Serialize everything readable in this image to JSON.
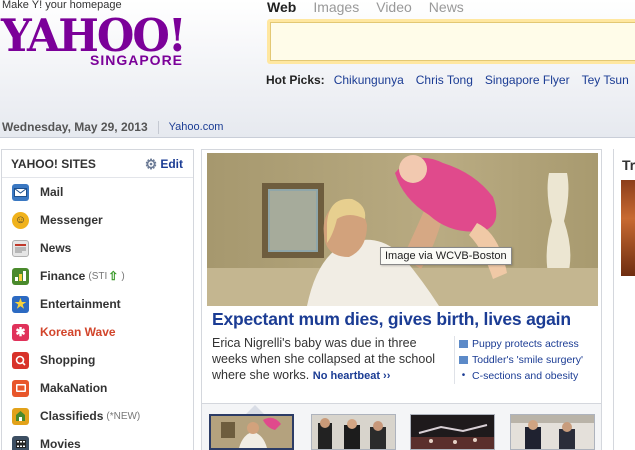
{
  "header": {
    "make_homepage": "Make Y! your homepage",
    "logo_word": "YAHOO!",
    "logo_region": "SINGAPORE",
    "search_tabs": [
      "Web",
      "Images",
      "Video",
      "News"
    ],
    "search_placeholder": "",
    "hot_picks_label": "Hot Picks:",
    "hot_picks": [
      "Chikungunya",
      "Chris Tong",
      "Singapore Flyer",
      "Tey Tsun"
    ],
    "date": "Wednesday, May 29, 2013",
    "site_link": "Yahoo.com"
  },
  "sidebar": {
    "title": "YAHOO! SITES",
    "edit_label": "Edit",
    "items": [
      {
        "label": "Mail",
        "suffix": "",
        "icon": "mail-icon",
        "color": "#3a78c2"
      },
      {
        "label": "Messenger",
        "suffix": "",
        "icon": "messenger-icon",
        "color": "#f0b21c"
      },
      {
        "label": "News",
        "suffix": "",
        "icon": "news-icon",
        "color": "#d9d9d9"
      },
      {
        "label": "Finance",
        "suffix": "(STI",
        "icon": "finance-icon",
        "color": "#4a8a2c"
      },
      {
        "label": "Entertainment",
        "suffix": "",
        "icon": "entertainment-icon",
        "color": "#f2b51d"
      },
      {
        "label": "Korean Wave",
        "suffix": "",
        "icon": "korean-wave-icon",
        "color": "#e0325a"
      },
      {
        "label": "Shopping",
        "suffix": "",
        "icon": "shopping-icon",
        "color": "#d8322a"
      },
      {
        "label": "MakaNation",
        "suffix": "",
        "icon": "makanation-icon",
        "color": "#e8562a"
      },
      {
        "label": "Classifieds",
        "suffix": "(*NEW)",
        "icon": "classifieds-icon",
        "color": "#e2a21a"
      },
      {
        "label": "Movies",
        "suffix": "",
        "icon": "movies-icon",
        "color": "#3c4e62"
      }
    ]
  },
  "news": {
    "photo_tooltip": "Image via WCVB-Boston",
    "headline": "Expectant mum dies, gives birth, lives again",
    "summary": "Erica Nigrelli's baby was due in three weeks when she collapsed at the school where she works.",
    "more_link": "No heartbeat ››",
    "related": [
      {
        "text": "Puppy protects actress",
        "icon": "video-icon"
      },
      {
        "text": "Toddler's 'smile surgery'",
        "icon": "video-icon"
      },
      {
        "text": "C-sections and obesity",
        "icon": "bullet"
      }
    ]
  },
  "right_col": {
    "title_fragment": "Tr"
  }
}
